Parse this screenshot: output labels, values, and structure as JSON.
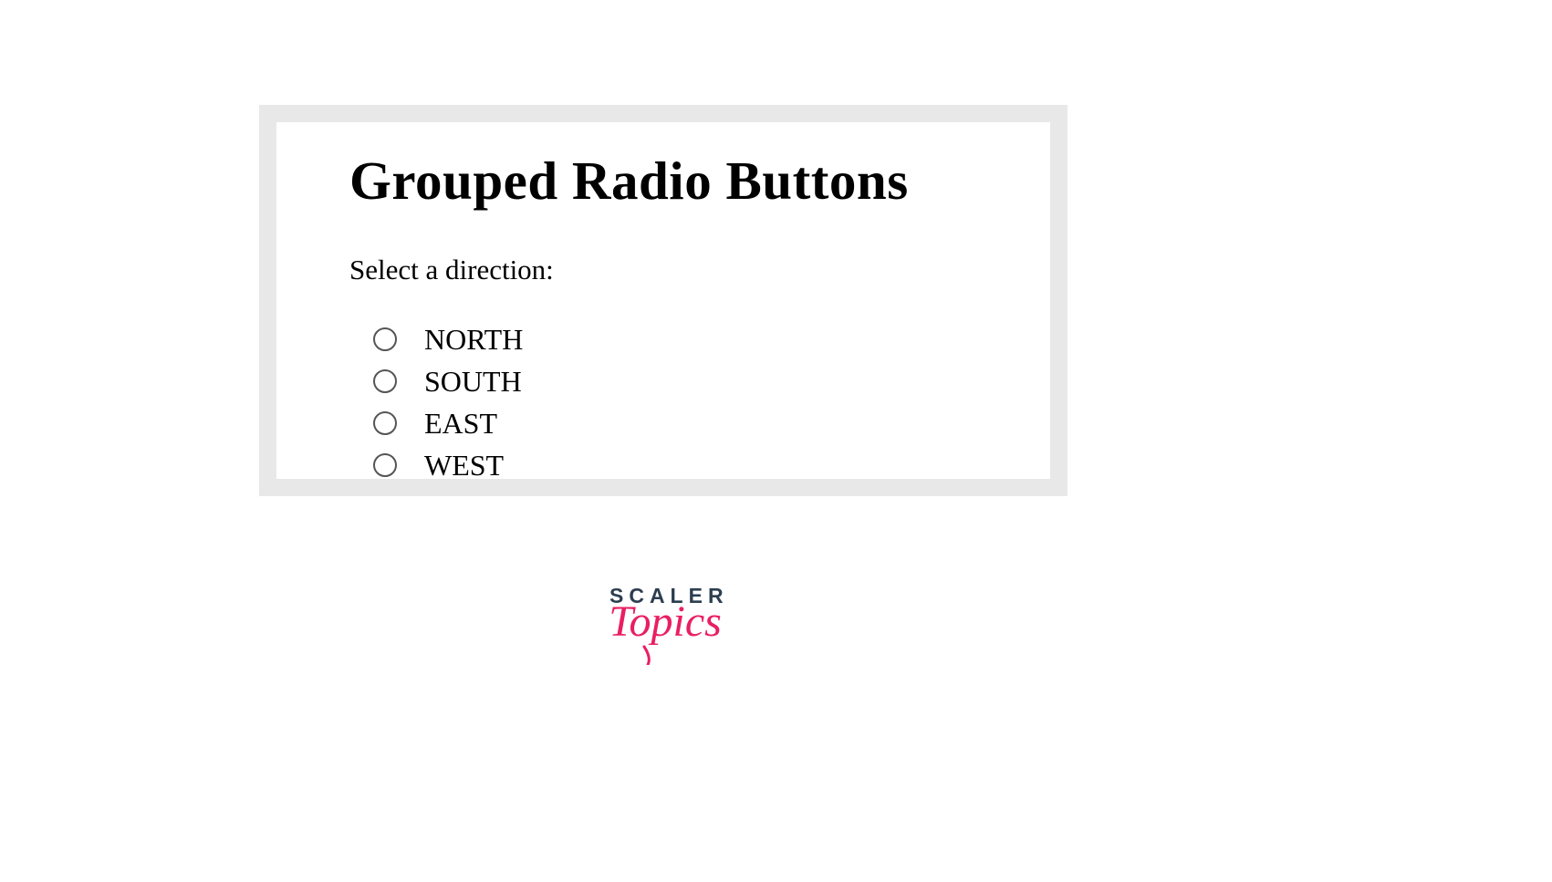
{
  "heading": "Grouped Radio Buttons",
  "prompt": "Select a direction:",
  "options": [
    {
      "label": "NORTH"
    },
    {
      "label": "SOUTH"
    },
    {
      "label": "EAST"
    },
    {
      "label": "WEST"
    }
  ],
  "logo": {
    "top": "SCALER",
    "bottom": "Topics"
  }
}
